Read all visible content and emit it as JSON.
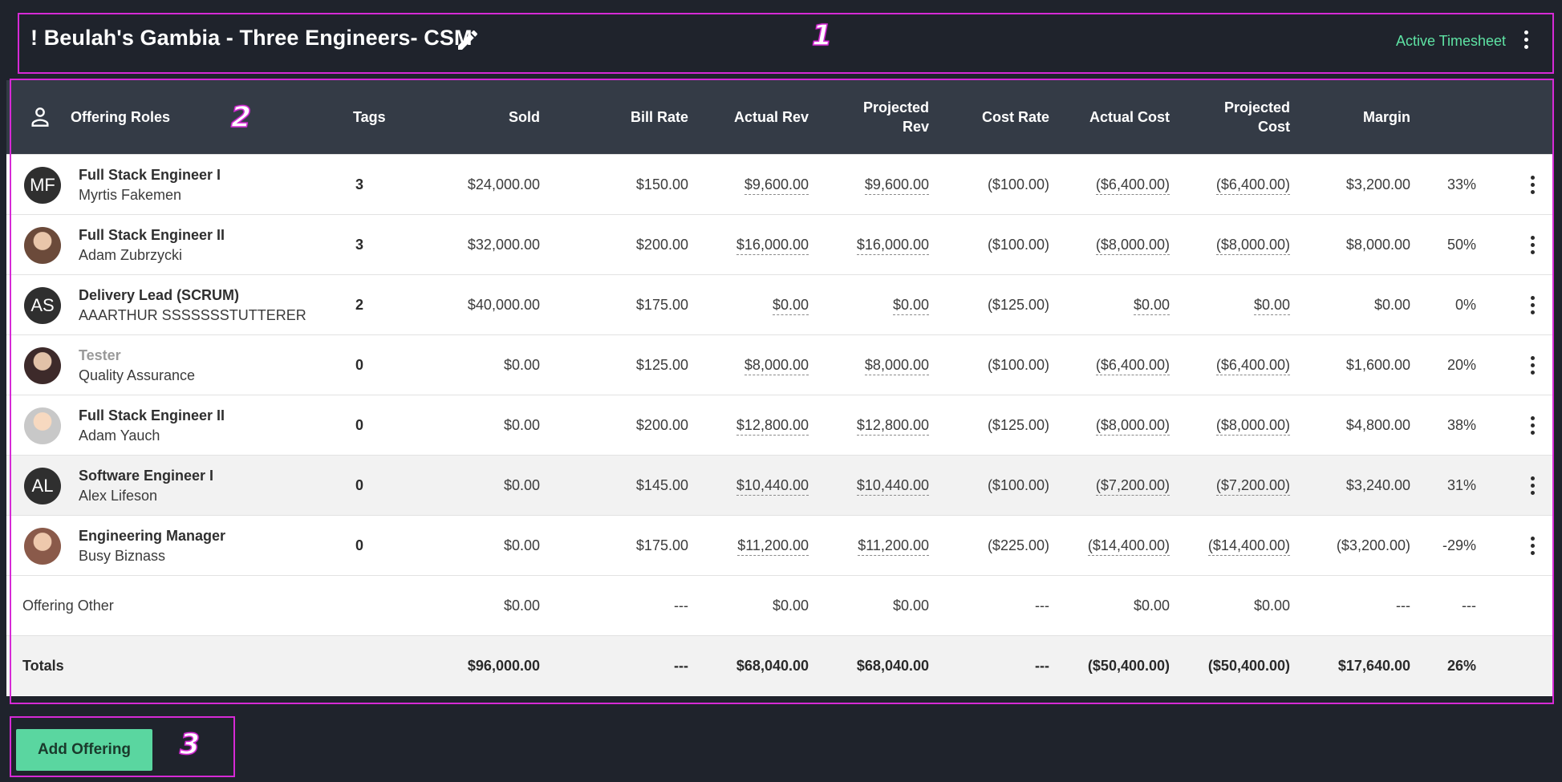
{
  "header": {
    "title": "! Beulah's Gambia - Three Engineers- CSM",
    "status": "Active Timesheet",
    "edit_icon": "pencil-icon",
    "menu_icon": "more-vertical-icon"
  },
  "annotations": [
    "1",
    "2",
    "3"
  ],
  "table": {
    "columns": {
      "roles": "Offering Roles",
      "tags": "Tags",
      "sold": "Sold",
      "bill_rate": "Bill Rate",
      "actual_rev": "Actual Rev",
      "projected_rev_1": "Projected",
      "projected_rev_2": "Rev",
      "cost_rate": "Cost Rate",
      "actual_cost": "Actual Cost",
      "projected_cost_1": "Projected",
      "projected_cost_2": "Cost",
      "margin": "Margin"
    },
    "rows": [
      {
        "initials": "MF",
        "role": "Full Stack Engineer I",
        "person": "Myrtis Fakemen",
        "tags": "3",
        "sold": "$24,000.00",
        "bill_rate": "$150.00",
        "actual_rev": "$9,600.00",
        "projected_rev": "$9,600.00",
        "cost_rate": "($100.00)",
        "actual_cost": "($6,400.00)",
        "projected_cost": "($6,400.00)",
        "margin": "$3,200.00",
        "margin_pct": "33%"
      },
      {
        "initials": "",
        "role": "Full Stack Engineer II",
        "person": "Adam Zubrzycki",
        "tags": "3",
        "sold": "$32,000.00",
        "bill_rate": "$200.00",
        "actual_rev": "$16,000.00",
        "projected_rev": "$16,000.00",
        "cost_rate": "($100.00)",
        "actual_cost": "($8,000.00)",
        "projected_cost": "($8,000.00)",
        "margin": "$8,000.00",
        "margin_pct": "50%"
      },
      {
        "initials": "AS",
        "role": "Delivery Lead (SCRUM)",
        "person": "AAARTHUR SSSSSSSTUTTERER",
        "tags": "2",
        "sold": "$40,000.00",
        "bill_rate": "$175.00",
        "actual_rev": "$0.00",
        "projected_rev": "$0.00",
        "cost_rate": "($125.00)",
        "actual_cost": "$0.00",
        "projected_cost": "$0.00",
        "margin": "$0.00",
        "margin_pct": "0%"
      },
      {
        "initials": "",
        "role": "Tester",
        "person": "Quality Assurance",
        "tags": "0",
        "sold": "$0.00",
        "bill_rate": "$125.00",
        "actual_rev": "$8,000.00",
        "projected_rev": "$8,000.00",
        "cost_rate": "($100.00)",
        "actual_cost": "($6,400.00)",
        "projected_cost": "($6,400.00)",
        "margin": "$1,600.00",
        "margin_pct": "20%"
      },
      {
        "initials": "",
        "role": "Full Stack Engineer II",
        "person": "Adam Yauch",
        "tags": "0",
        "sold": "$0.00",
        "bill_rate": "$200.00",
        "actual_rev": "$12,800.00",
        "projected_rev": "$12,800.00",
        "cost_rate": "($125.00)",
        "actual_cost": "($8,000.00)",
        "projected_cost": "($8,000.00)",
        "margin": "$4,800.00",
        "margin_pct": "38%"
      },
      {
        "initials": "AL",
        "role": "Software Engineer I",
        "person": "Alex Lifeson",
        "tags": "0",
        "sold": "$0.00",
        "bill_rate": "$145.00",
        "actual_rev": "$10,440.00",
        "projected_rev": "$10,440.00",
        "cost_rate": "($100.00)",
        "actual_cost": "($7,200.00)",
        "projected_cost": "($7,200.00)",
        "margin": "$3,240.00",
        "margin_pct": "31%"
      },
      {
        "initials": "",
        "role": "Engineering Manager",
        "person": "Busy Biznass",
        "tags": "0",
        "sold": "$0.00",
        "bill_rate": "$175.00",
        "actual_rev": "$11,200.00",
        "projected_rev": "$11,200.00",
        "cost_rate": "($225.00)",
        "actual_cost": "($14,400.00)",
        "projected_cost": "($14,400.00)",
        "margin": "($3,200.00)",
        "margin_pct": "-29%"
      }
    ],
    "other": {
      "label": "Offering Other",
      "sold": "$0.00",
      "bill_rate": "---",
      "actual_rev": "$0.00",
      "projected_rev": "$0.00",
      "cost_rate": "---",
      "actual_cost": "$0.00",
      "projected_cost": "$0.00",
      "margin": "---",
      "margin_pct": "---"
    },
    "totals": {
      "label": "Totals",
      "sold": "$96,000.00",
      "bill_rate": "---",
      "actual_rev": "$68,040.00",
      "projected_rev": "$68,040.00",
      "cost_rate": "---",
      "actual_cost": "($50,400.00)",
      "projected_cost": "($50,400.00)",
      "margin": "$17,640.00",
      "margin_pct": "26%"
    }
  },
  "footer": {
    "add_button": "Add Offering"
  },
  "colors": {
    "accent": "#5ee3a4",
    "button": "#5ad6a0",
    "header_bg": "#343b46",
    "page_bg": "#1f232c",
    "highlight": "#d62ad6"
  }
}
